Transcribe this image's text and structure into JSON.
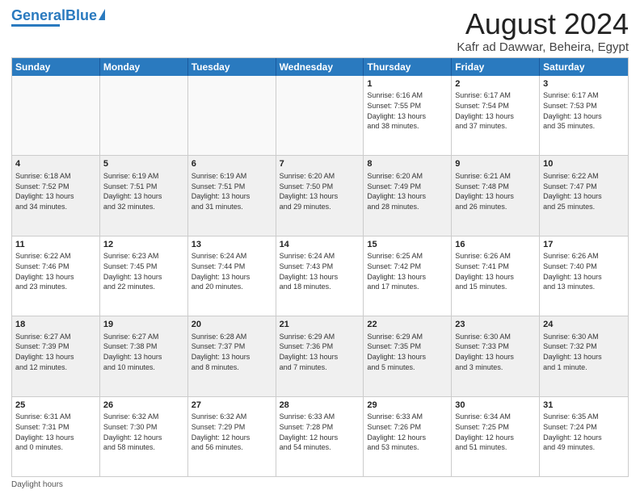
{
  "logo": {
    "text_general": "General",
    "text_blue": "Blue"
  },
  "title": "August 2024",
  "subtitle": "Kafr ad Dawwar, Beheira, Egypt",
  "header_days": [
    "Sunday",
    "Monday",
    "Tuesday",
    "Wednesday",
    "Thursday",
    "Friday",
    "Saturday"
  ],
  "weeks": [
    [
      {
        "day": "",
        "info": "",
        "empty": true
      },
      {
        "day": "",
        "info": "",
        "empty": true
      },
      {
        "day": "",
        "info": "",
        "empty": true
      },
      {
        "day": "",
        "info": "",
        "empty": true
      },
      {
        "day": "1",
        "info": "Sunrise: 6:16 AM\nSunset: 7:55 PM\nDaylight: 13 hours\nand 38 minutes.",
        "empty": false
      },
      {
        "day": "2",
        "info": "Sunrise: 6:17 AM\nSunset: 7:54 PM\nDaylight: 13 hours\nand 37 minutes.",
        "empty": false
      },
      {
        "day": "3",
        "info": "Sunrise: 6:17 AM\nSunset: 7:53 PM\nDaylight: 13 hours\nand 35 minutes.",
        "empty": false
      }
    ],
    [
      {
        "day": "4",
        "info": "Sunrise: 6:18 AM\nSunset: 7:52 PM\nDaylight: 13 hours\nand 34 minutes.",
        "empty": false
      },
      {
        "day": "5",
        "info": "Sunrise: 6:19 AM\nSunset: 7:51 PM\nDaylight: 13 hours\nand 32 minutes.",
        "empty": false
      },
      {
        "day": "6",
        "info": "Sunrise: 6:19 AM\nSunset: 7:51 PM\nDaylight: 13 hours\nand 31 minutes.",
        "empty": false
      },
      {
        "day": "7",
        "info": "Sunrise: 6:20 AM\nSunset: 7:50 PM\nDaylight: 13 hours\nand 29 minutes.",
        "empty": false
      },
      {
        "day": "8",
        "info": "Sunrise: 6:20 AM\nSunset: 7:49 PM\nDaylight: 13 hours\nand 28 minutes.",
        "empty": false
      },
      {
        "day": "9",
        "info": "Sunrise: 6:21 AM\nSunset: 7:48 PM\nDaylight: 13 hours\nand 26 minutes.",
        "empty": false
      },
      {
        "day": "10",
        "info": "Sunrise: 6:22 AM\nSunset: 7:47 PM\nDaylight: 13 hours\nand 25 minutes.",
        "empty": false
      }
    ],
    [
      {
        "day": "11",
        "info": "Sunrise: 6:22 AM\nSunset: 7:46 PM\nDaylight: 13 hours\nand 23 minutes.",
        "empty": false
      },
      {
        "day": "12",
        "info": "Sunrise: 6:23 AM\nSunset: 7:45 PM\nDaylight: 13 hours\nand 22 minutes.",
        "empty": false
      },
      {
        "day": "13",
        "info": "Sunrise: 6:24 AM\nSunset: 7:44 PM\nDaylight: 13 hours\nand 20 minutes.",
        "empty": false
      },
      {
        "day": "14",
        "info": "Sunrise: 6:24 AM\nSunset: 7:43 PM\nDaylight: 13 hours\nand 18 minutes.",
        "empty": false
      },
      {
        "day": "15",
        "info": "Sunrise: 6:25 AM\nSunset: 7:42 PM\nDaylight: 13 hours\nand 17 minutes.",
        "empty": false
      },
      {
        "day": "16",
        "info": "Sunrise: 6:26 AM\nSunset: 7:41 PM\nDaylight: 13 hours\nand 15 minutes.",
        "empty": false
      },
      {
        "day": "17",
        "info": "Sunrise: 6:26 AM\nSunset: 7:40 PM\nDaylight: 13 hours\nand 13 minutes.",
        "empty": false
      }
    ],
    [
      {
        "day": "18",
        "info": "Sunrise: 6:27 AM\nSunset: 7:39 PM\nDaylight: 13 hours\nand 12 minutes.",
        "empty": false
      },
      {
        "day": "19",
        "info": "Sunrise: 6:27 AM\nSunset: 7:38 PM\nDaylight: 13 hours\nand 10 minutes.",
        "empty": false
      },
      {
        "day": "20",
        "info": "Sunrise: 6:28 AM\nSunset: 7:37 PM\nDaylight: 13 hours\nand 8 minutes.",
        "empty": false
      },
      {
        "day": "21",
        "info": "Sunrise: 6:29 AM\nSunset: 7:36 PM\nDaylight: 13 hours\nand 7 minutes.",
        "empty": false
      },
      {
        "day": "22",
        "info": "Sunrise: 6:29 AM\nSunset: 7:35 PM\nDaylight: 13 hours\nand 5 minutes.",
        "empty": false
      },
      {
        "day": "23",
        "info": "Sunrise: 6:30 AM\nSunset: 7:33 PM\nDaylight: 13 hours\nand 3 minutes.",
        "empty": false
      },
      {
        "day": "24",
        "info": "Sunrise: 6:30 AM\nSunset: 7:32 PM\nDaylight: 13 hours\nand 1 minute.",
        "empty": false
      }
    ],
    [
      {
        "day": "25",
        "info": "Sunrise: 6:31 AM\nSunset: 7:31 PM\nDaylight: 13 hours\nand 0 minutes.",
        "empty": false
      },
      {
        "day": "26",
        "info": "Sunrise: 6:32 AM\nSunset: 7:30 PM\nDaylight: 12 hours\nand 58 minutes.",
        "empty": false
      },
      {
        "day": "27",
        "info": "Sunrise: 6:32 AM\nSunset: 7:29 PM\nDaylight: 12 hours\nand 56 minutes.",
        "empty": false
      },
      {
        "day": "28",
        "info": "Sunrise: 6:33 AM\nSunset: 7:28 PM\nDaylight: 12 hours\nand 54 minutes.",
        "empty": false
      },
      {
        "day": "29",
        "info": "Sunrise: 6:33 AM\nSunset: 7:26 PM\nDaylight: 12 hours\nand 53 minutes.",
        "empty": false
      },
      {
        "day": "30",
        "info": "Sunrise: 6:34 AM\nSunset: 7:25 PM\nDaylight: 12 hours\nand 51 minutes.",
        "empty": false
      },
      {
        "day": "31",
        "info": "Sunrise: 6:35 AM\nSunset: 7:24 PM\nDaylight: 12 hours\nand 49 minutes.",
        "empty": false
      }
    ]
  ],
  "footer": "Daylight hours"
}
